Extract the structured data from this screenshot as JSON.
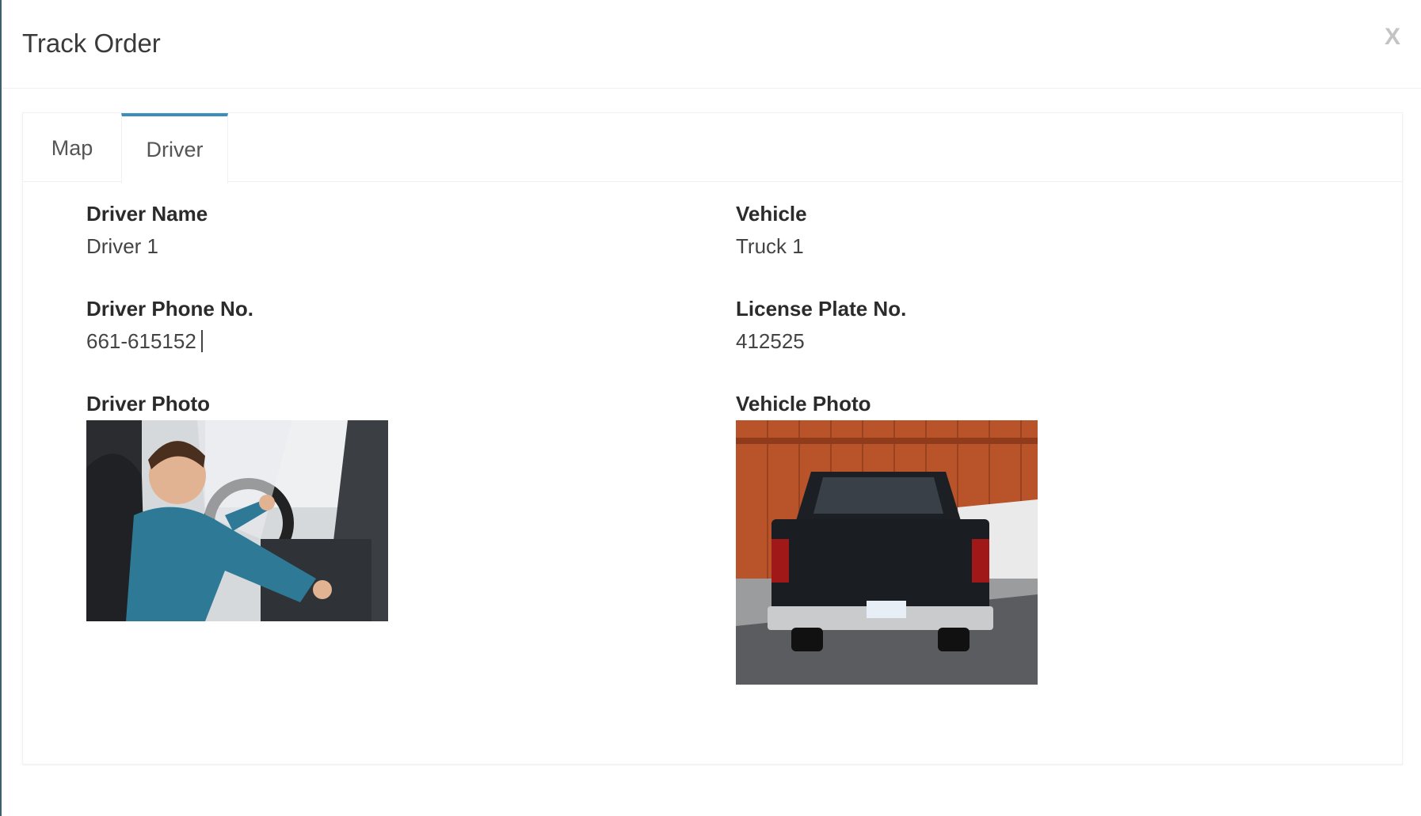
{
  "modal": {
    "title": "Track Order",
    "close_label": "X"
  },
  "tabs": [
    {
      "label": "Map",
      "active": false
    },
    {
      "label": "Driver",
      "active": true
    }
  ],
  "driver": {
    "name_label": "Driver Name",
    "name_value": "Driver 1",
    "phone_label": "Driver Phone No.",
    "phone_value": "661-615152",
    "photo_label": "Driver Photo"
  },
  "vehicle": {
    "vehicle_label": "Vehicle",
    "vehicle_value": "Truck 1",
    "plate_label": "License Plate No.",
    "plate_value": "412525",
    "photo_label": "Vehicle Photo"
  },
  "colors": {
    "accent": "#3c8dbc",
    "edge": "#3f5f6f"
  }
}
